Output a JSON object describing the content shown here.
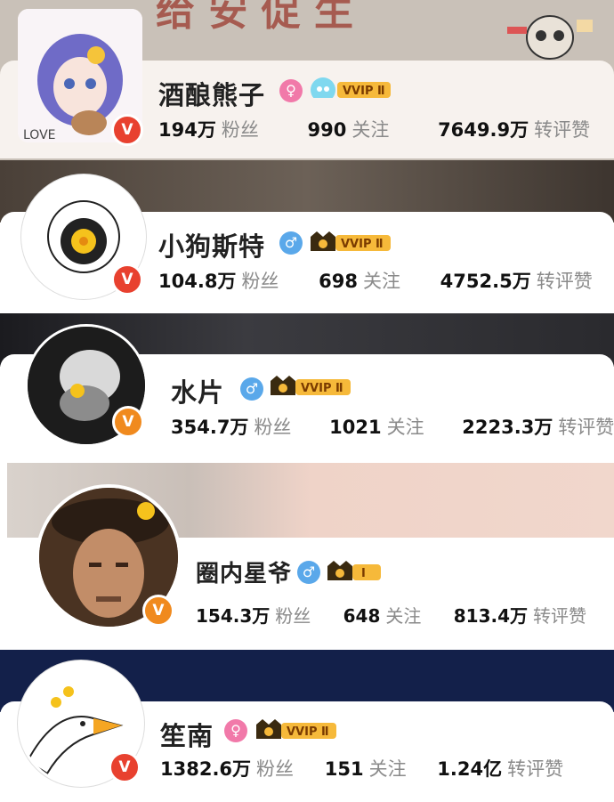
{
  "users": [
    {
      "name": "酒酿熊子",
      "gender": "female",
      "gender_symbol": "♀",
      "vip_level": "VVIP Ⅱ",
      "verified_symbol": "V",
      "stats": [
        {
          "value": "194万",
          "label": "粉丝"
        },
        {
          "value": "990",
          "label": "关注"
        },
        {
          "value": "7649.9万",
          "label": "转评赞"
        }
      ]
    },
    {
      "name": "小狗斯特",
      "gender": "male",
      "gender_symbol": "♂",
      "vip_level": "VVIP Ⅱ",
      "verified_symbol": "V",
      "stats": [
        {
          "value": "104.8万",
          "label": "粉丝"
        },
        {
          "value": "698",
          "label": "关注"
        },
        {
          "value": "4752.5万",
          "label": "转评赞"
        }
      ]
    },
    {
      "name": "水片",
      "gender": "male",
      "gender_symbol": "♂",
      "vip_level": "VVIP Ⅱ",
      "verified_symbol": "V",
      "stats": [
        {
          "value": "354.7万",
          "label": "粉丝"
        },
        {
          "value": "1021",
          "label": "关注"
        },
        {
          "value": "2223.3万",
          "label": "转评赞"
        }
      ]
    },
    {
      "name": "圈内星爷",
      "gender": "male",
      "gender_symbol": "♂",
      "vip_level": "Ⅰ",
      "verified_symbol": "V",
      "stats": [
        {
          "value": "154.3万",
          "label": "粉丝"
        },
        {
          "value": "648",
          "label": "关注"
        },
        {
          "value": "813.4万",
          "label": "转评赞"
        }
      ]
    },
    {
      "name": "笙南",
      "gender": "female",
      "gender_symbol": "♀",
      "vip_level": "VVIP Ⅱ",
      "verified_symbol": "V",
      "stats": [
        {
          "value": "1382.6万",
          "label": "粉丝"
        },
        {
          "value": "151",
          "label": "关注"
        },
        {
          "value": "1.24亿",
          "label": "转评赞"
        }
      ]
    }
  ],
  "colors": {
    "vip_gold": "#f6b93a",
    "verified_orange": "#f08a1e",
    "verified_red": "#e8412f",
    "gender_female": "#f179a9",
    "gender_male": "#5aa8ea",
    "stat_label_gray": "#8a8a8a",
    "banner_navy": "#13204a"
  }
}
